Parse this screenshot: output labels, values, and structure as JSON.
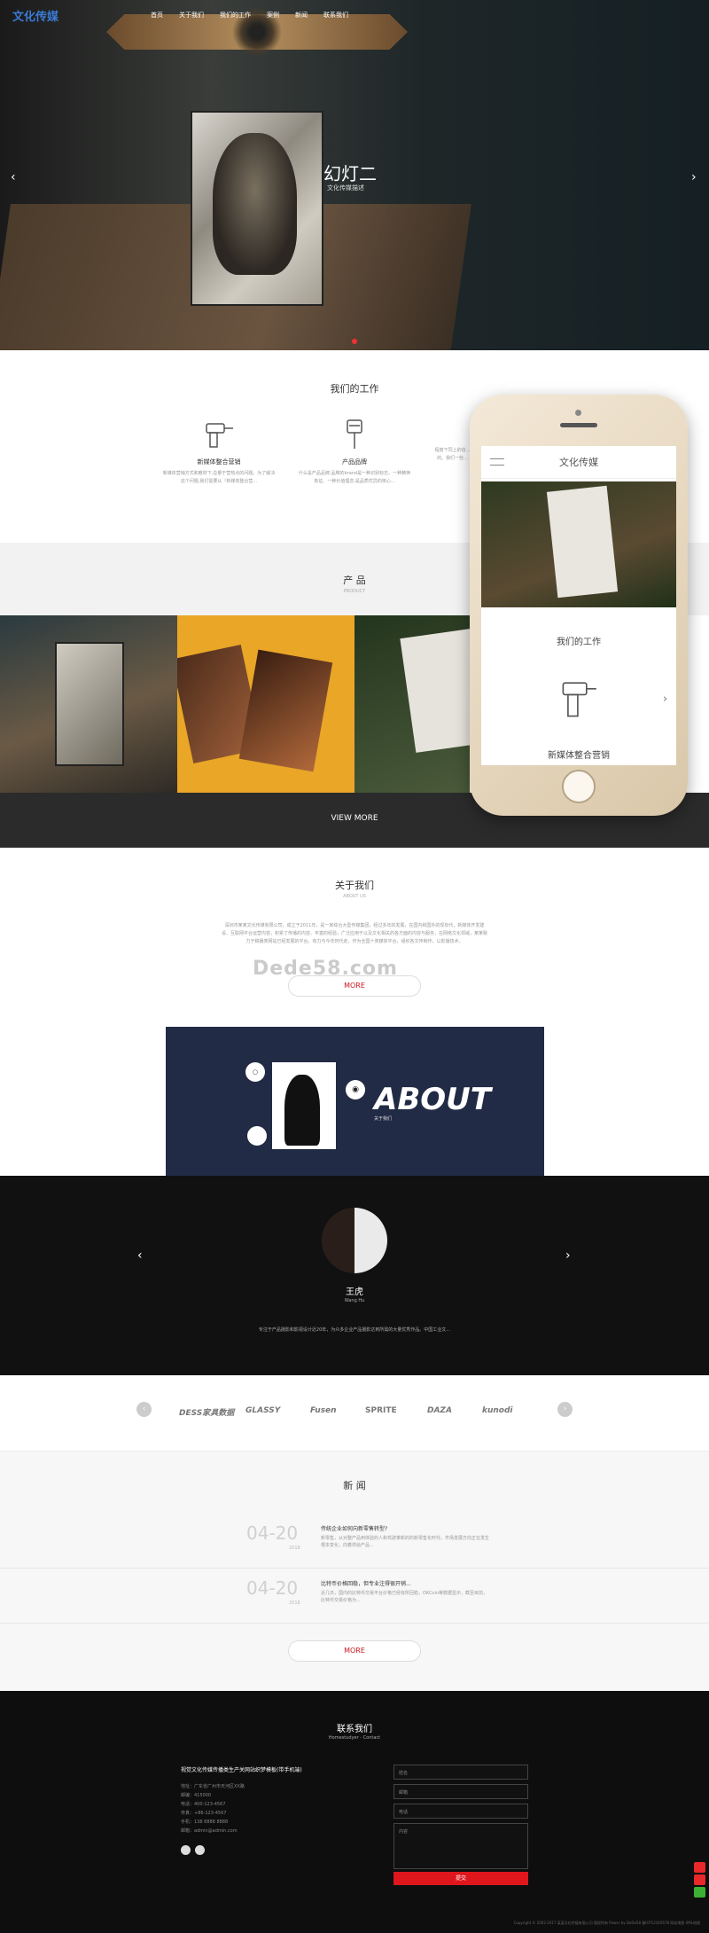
{
  "header": {
    "logo": "文化传媒",
    "nav": [
      "首页",
      "关于我们",
      "我们的工作",
      "案例",
      "新闻",
      "联系我们"
    ]
  },
  "hero": {
    "title": "幻灯二",
    "subtitle": "文化传媒描述",
    "prev_icon": "chevron-left-icon",
    "next_icon": "chevron-right-icon"
  },
  "work": {
    "title": "我们的工作",
    "items": [
      {
        "title": "新媒体整合营销",
        "desc": "新媒体营销方式和教材下,总量于营热点的问题。为了解决这个问题,我们需要从『新媒体整合营...",
        "icon": "drill-icon"
      },
      {
        "title": "产品品牌",
        "desc": "什么是产品品牌,品牌的brand是一种识别标志、一种精神象征、一种价值理念,是品质优异的核心...",
        "icon": "hammer-drill-icon"
      },
      {
        "title": "",
        "desc": "程度下同上的信...的。我们一些...",
        "icon": ""
      }
    ]
  },
  "phone": {
    "title": "文化传媒",
    "menu_icon": "menu-icon",
    "section_title": "我们的工作",
    "item_title": "新媒体整合营销",
    "item_icon": "drill-icon",
    "next_icon": "chevron-right-icon"
  },
  "products": {
    "title": "产 品",
    "subtitle": "PRODUCT",
    "view_more": "VIEW MORE"
  },
  "about": {
    "title": "关于我们",
    "subtitle": "ABOUT US",
    "text": "深圳市某某文化传媒有限公司，成立于2011年，是一家综合大型传媒集团，经过多年的发展，在国内和国外的现有代，新媒体开发建设、互联网平台运营内容，积累了传播的内容、丰富的经验，广泛应用于以及文化相关的各方面的内容与服务，在网络文化领域，某某致力于稿播类网站已经发展的平台，有力与今年时代走，作为全国十类媒体平台，组织各文传制作，以影播技术。",
    "more": "MORE",
    "watermark": "Dede58.com",
    "banner_title": "ABOUT",
    "banner_sub": "关于我们"
  },
  "team": {
    "name": "王虎",
    "role": "Wang Hu",
    "desc": "专注于产品摄影和影视设计近20年，为众多企业产品摄影达到所需的大量优秀作品。中国工业文...",
    "prev_icon": "chevron-left-icon",
    "next_icon": "chevron-right-icon"
  },
  "partners": {
    "logos": [
      "DESS家具数据",
      "GLASSY",
      "Fusen",
      "SPRITE",
      "DAZA",
      "kunodi"
    ],
    "prev_icon": "chevron-left-icon",
    "next_icon": "chevron-right-icon"
  },
  "news": {
    "title": "新 闻",
    "items": [
      {
        "date": "04-20",
        "year": "2018",
        "title": "传统企业如何向新零售转型?",
        "desc": "新零售，从对整产品到体验的人和驾驶革新的的新零售化时代，市场发展方向正在发生根本变化，向着供给产品..."
      },
      {
        "date": "04-20",
        "year": "2018",
        "title": "比特币价格回稳，但专业注得很开销...",
        "desc": "近几日，国内的比特币交易平台价格已经有所回稳，OKCoin等数据显示，截至目前，比特币交易价格为..."
      }
    ],
    "more": "MORE"
  },
  "contact": {
    "title": "联系我们",
    "subtitle": "Homestudyer - Contact",
    "company": "视觉文化传媒传播类生产关网站织梦模板(带手机端)",
    "lines": [
      "地址：广东省广州市天河区XX路",
      "邮编：415000",
      "电话：400-123-4567",
      "传真：+86-123-4567",
      "手机：138 8888 8888",
      "邮箱：admin@admin.com"
    ],
    "fields": [
      "姓名",
      "邮箱",
      "电话",
      "内容"
    ],
    "submit": "提交",
    "copyright": "Copyright © 2002-2017 某某文化传媒有限公司 版权所有    Power by DeDe58    备ICP12345678    网站地图    XML地图"
  },
  "colors": {
    "accent": "#c8161d",
    "dark": "#111111",
    "logo": "#3a7bd5"
  }
}
